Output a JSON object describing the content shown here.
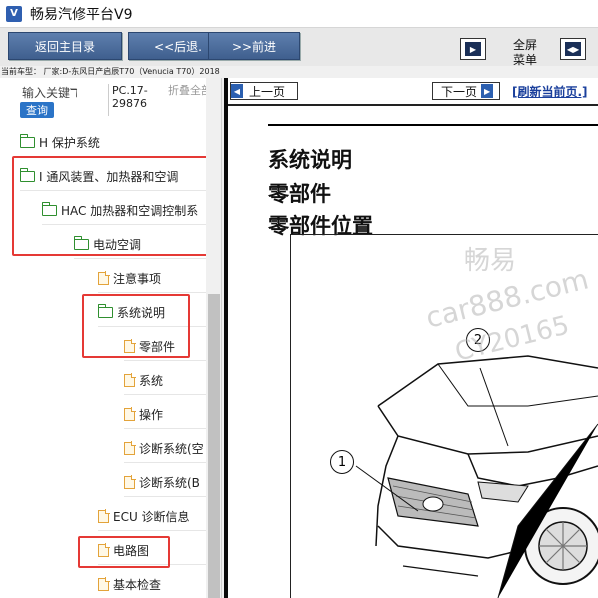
{
  "window": {
    "title": "畅易汽修平台V9",
    "icon": "app-logo-icon"
  },
  "toolbar": {
    "back_home": "返回主目录",
    "prev": "<<后退.",
    "next": ">>前进",
    "fullscreen_line1": "全屏",
    "fullscreen_line2": "菜单"
  },
  "car_info": "当前车型： 厂家:D-东风日产启辰T70（Venucia T70）2018",
  "search": {
    "keyword_placeholder": "输入关键ℸ",
    "search_button": "查询",
    "code": "PC.17-29876",
    "collapse_all": "折叠全部"
  },
  "tree": {
    "items": [
      {
        "label": "H 保护系统",
        "icon": "folder-icon"
      },
      {
        "label": "I 通风装置、加热器和空调",
        "icon": "folder-open-icon"
      },
      {
        "label": "HAC 加热器和空调控制系",
        "icon": "folder-open-icon"
      },
      {
        "label": "电动空调",
        "icon": "folder-open-icon"
      },
      {
        "label": "注意事项",
        "icon": "document-icon"
      },
      {
        "label": "系统说明",
        "icon": "folder-open-icon"
      },
      {
        "label": "零部件",
        "icon": "document-icon"
      },
      {
        "label": "系统",
        "icon": "document-icon"
      },
      {
        "label": "操作",
        "icon": "document-icon"
      },
      {
        "label": "诊断系统(空",
        "icon": "document-icon"
      },
      {
        "label": "诊断系统(B",
        "icon": "document-icon"
      },
      {
        "label": "ECU 诊断信息",
        "icon": "document-icon"
      },
      {
        "label": "电路图",
        "icon": "document-icon"
      },
      {
        "label": "基本检查",
        "icon": "document-icon"
      }
    ]
  },
  "page_nav": {
    "prev_page": "上一页",
    "next_page": "下一页",
    "refresh": "[刷新当前页.]"
  },
  "document": {
    "heading1": "系统说明",
    "heading2": "零部件",
    "heading3": "零部件位置",
    "callouts": [
      "1",
      "2"
    ]
  },
  "watermark": {
    "line1": "畅易",
    "line2": "car888.com",
    "line3": "CY20165"
  },
  "colors": {
    "highlight": "#e53935",
    "toolbar_button": "#4a6a99",
    "search_button": "#2b74c7",
    "link": "#1a3f9c"
  }
}
